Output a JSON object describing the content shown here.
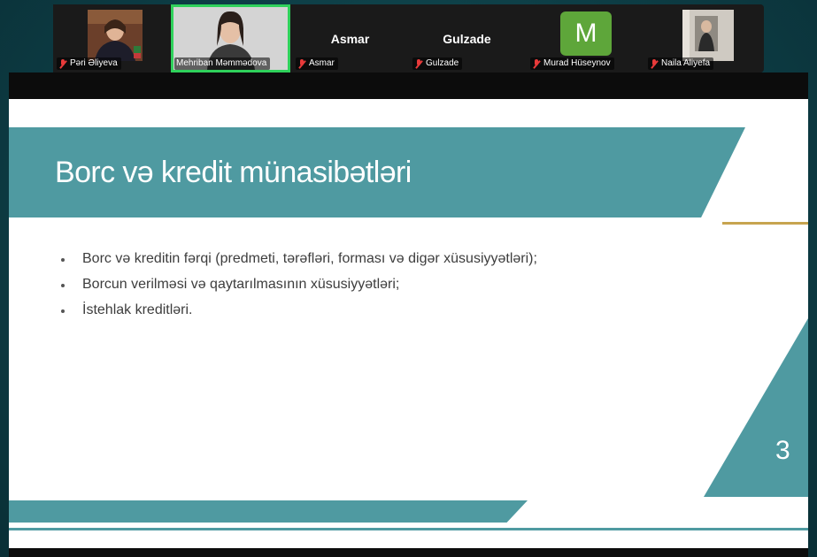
{
  "participants": [
    {
      "name": "Pəri Əliyeva",
      "muted": true
    },
    {
      "name": "Mehriban Məmmədova",
      "muted": false,
      "active_speaker": true
    },
    {
      "name": "Asmar",
      "display": "Asmar",
      "muted": true
    },
    {
      "name": "Gulzade",
      "display": "Gulzade",
      "muted": true
    },
    {
      "name": "Murad Hüseynov",
      "avatar_letter": "M",
      "muted": true
    },
    {
      "name": "Naila Aliyefa",
      "muted": true
    }
  ],
  "slide": {
    "title": "Borc və kredit münasibətləri",
    "bullets": [
      "Borc və kreditin fərqi (predmeti, tərəfləri, forması və digər xüsusiyyətləri);",
      "Borcun verilməsi və qaytarılmasının xüsusiyyətləri;",
      "İstehlak kreditləri."
    ],
    "page_number": "3"
  },
  "colors": {
    "teal": "#4f9aa1",
    "gold": "#c7a44f",
    "active_border": "#2fd15b",
    "avatar_green": "#5ea63a",
    "muted_icon": "#e83a3a"
  }
}
